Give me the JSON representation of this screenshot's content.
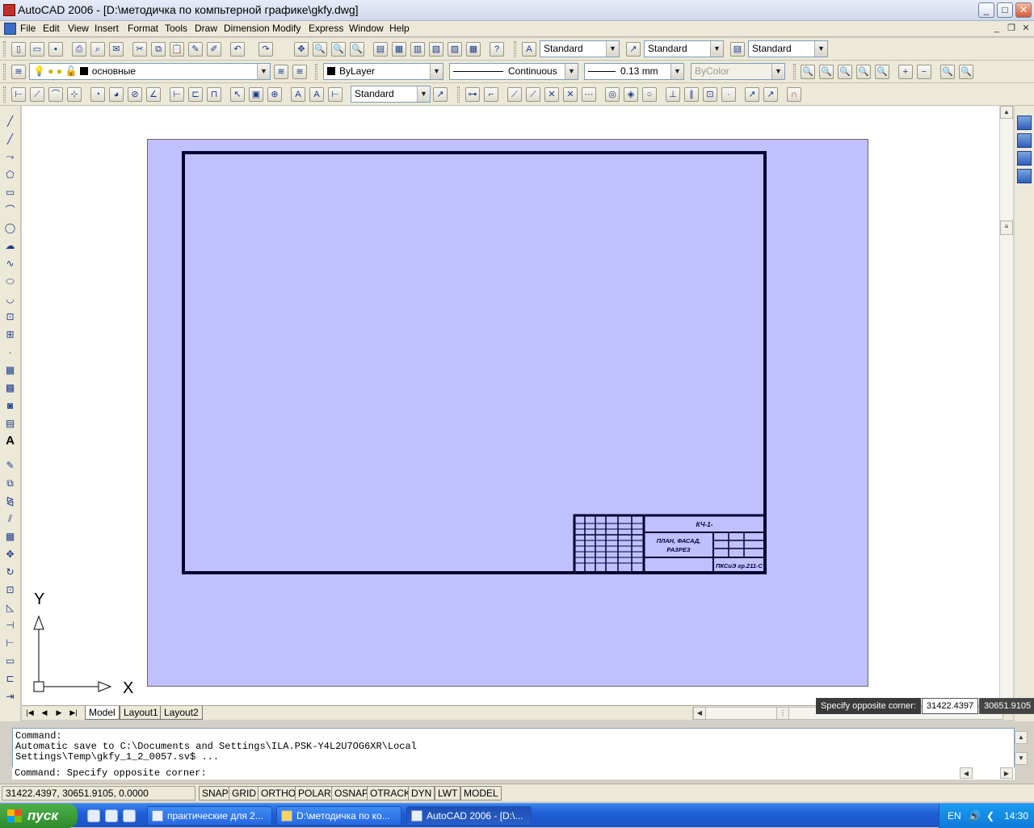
{
  "window": {
    "title": "AutoCAD 2006 - [D:\\методичка по компьтерной графике\\gkfy.dwg]"
  },
  "menu": [
    "File",
    "Edit",
    "View",
    "Insert",
    "Format",
    "Tools",
    "Draw",
    "Dimension",
    "Modify",
    "Express",
    "Window",
    "Help"
  ],
  "styles": {
    "text_style": "Standard",
    "dim_style": "Standard",
    "table_style": "Standard"
  },
  "layers": {
    "current_layer": "основные",
    "color": "ByLayer",
    "linetype": "Continuous",
    "lineweight": "0.13 mm",
    "plot_style": "ByColor"
  },
  "dim_toolbar": {
    "dim_style": "Standard"
  },
  "layout_tabs": [
    "Model",
    "Layout1",
    "Layout2"
  ],
  "drawing": {
    "title_block": {
      "code": "КЧ-1-",
      "name_line1": "ПЛАН, ФАСАД,",
      "name_line2": "РАЗРЕЗ",
      "group": "ПКСиЭ гр.211-С"
    },
    "ucs": {
      "x_label": "X",
      "y_label": "Y"
    }
  },
  "dynamic_input": {
    "prompt": "Specify opposite corner:",
    "x": "31422.4397",
    "y": "30651.9105"
  },
  "command_history": [
    "Command:",
    "Automatic save to C:\\Documents and Settings\\ILA.PSK-Y4L2U7OG6XR\\Local",
    "Settings\\Temp\\gkfy_1_2_0057.sv$ ..."
  ],
  "command_prompt": "Command: Specify opposite corner:",
  "status": {
    "coordinates": "31422.4397, 30651.9105, 0.0000",
    "toggles": [
      "SNAP",
      "GRID",
      "ORTHO",
      "POLAR",
      "OSNAP",
      "OTRACK",
      "DYN",
      "LWT",
      "MODEL"
    ]
  },
  "taskbar": {
    "start_label": "пуск",
    "tasks": [
      "практические для 2...",
      "D:\\методичка по ко...",
      "AutoCAD 2006 - [D:\\..."
    ],
    "language": "EN",
    "clock": "14:30"
  },
  "colors": {
    "paper_bg": "#c0c0ff",
    "frame": "#000033",
    "taskbar": "#1f5fd6"
  }
}
